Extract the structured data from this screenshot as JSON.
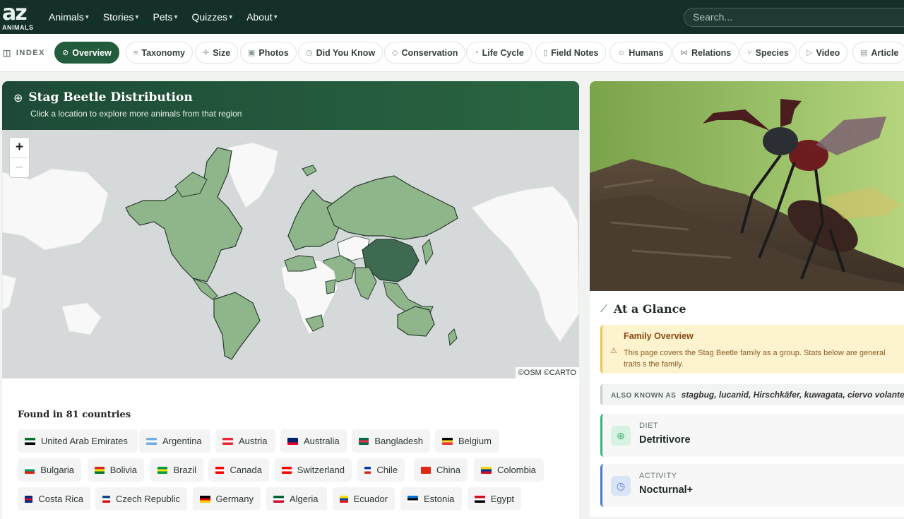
{
  "header": {
    "logo_main": "az",
    "logo_sub": "ANIMALS",
    "nav": [
      "Animals",
      "Stories",
      "Pets",
      "Quizzes",
      "About"
    ],
    "search_placeholder": "Search..."
  },
  "index_bar": {
    "label": "INDEX",
    "items": [
      {
        "label": "Overview",
        "icon": "compass-icon",
        "active": true
      },
      {
        "label": "Taxonomy",
        "icon": "list-icon"
      },
      {
        "label": "Size",
        "icon": "ruler-icon"
      },
      {
        "label": "Photos",
        "icon": "image-icon"
      },
      {
        "label": "Did You Know",
        "icon": "help-circle-icon"
      },
      {
        "label": "Conservation",
        "icon": "shield-icon"
      },
      {
        "label": "Life Cycle",
        "icon": "clock-icon"
      },
      {
        "label": "Field Notes",
        "icon": "clipboard-icon"
      },
      {
        "label": "Humans",
        "icon": "users-icon"
      },
      {
        "label": "Relations",
        "icon": "share-icon"
      },
      {
        "label": "Species",
        "icon": "branch-icon"
      },
      {
        "label": "Video",
        "icon": "play-icon"
      },
      {
        "label": "Article",
        "icon": "document-icon"
      }
    ]
  },
  "map": {
    "title": "Stag Beetle Distribution",
    "subtitle": "Click a location to explore more animals from that region",
    "zoom_in": "+",
    "zoom_out": "−",
    "attribution": "©OSM ©CARTO",
    "colors": {
      "ocean": "#d5d9da",
      "land": "#f7f8f7",
      "present": "#8fb58a",
      "highlight": "#3d6a51",
      "border": "#253b2d"
    }
  },
  "countries": {
    "heading": "Found in 81 countries",
    "list": [
      {
        "name": "United Arab Emirates",
        "flag": [
          "#00732f",
          "#ffffff",
          "#000000"
        ]
      },
      {
        "name": "Argentina",
        "flag": [
          "#74acdf",
          "#ffffff",
          "#74acdf"
        ]
      },
      {
        "name": "Austria",
        "flag": [
          "#ed2939",
          "#ffffff",
          "#ed2939"
        ]
      },
      {
        "name": "Australia",
        "flag": [
          "#012169",
          "#012169",
          "#e4002b"
        ]
      },
      {
        "name": "Bangladesh",
        "flag": [
          "#006a4e",
          "#f42a41",
          "#006a4e"
        ]
      },
      {
        "name": "Belgium",
        "flag": [
          "#000000",
          "#fdda24",
          "#ef3340"
        ]
      },
      {
        "name": "Bulgaria",
        "flag": [
          "#ffffff",
          "#00966e",
          "#d62612"
        ]
      },
      {
        "name": "Bolivia",
        "flag": [
          "#d52b1e",
          "#f9e300",
          "#007934"
        ]
      },
      {
        "name": "Brazil",
        "flag": [
          "#009c3b",
          "#ffdf00",
          "#009c3b"
        ]
      },
      {
        "name": "Canada",
        "flag": [
          "#ff0000",
          "#ffffff",
          "#ff0000"
        ]
      },
      {
        "name": "Switzerland",
        "flag": [
          "#ff0000",
          "#ffffff",
          "#ff0000"
        ]
      },
      {
        "name": "Chile",
        "flag": [
          "#0039a6",
          "#ffffff",
          "#d52b1e"
        ]
      },
      {
        "name": "China",
        "flag": [
          "#de2910",
          "#de2910",
          "#de2910"
        ]
      },
      {
        "name": "Colombia",
        "flag": [
          "#fcd116",
          "#003893",
          "#ce1126"
        ]
      },
      {
        "name": "Costa Rica",
        "flag": [
          "#002b7f",
          "#ce1126",
          "#002b7f"
        ]
      },
      {
        "name": "Czech Republic",
        "flag": [
          "#11457e",
          "#ffffff",
          "#d7141a"
        ]
      },
      {
        "name": "Germany",
        "flag": [
          "#000000",
          "#dd0000",
          "#ffce00"
        ]
      },
      {
        "name": "Algeria",
        "flag": [
          "#006233",
          "#ffffff",
          "#d21034"
        ]
      },
      {
        "name": "Ecuador",
        "flag": [
          "#ffdd00",
          "#034ea2",
          "#ed1c24"
        ]
      },
      {
        "name": "Estonia",
        "flag": [
          "#0072ce",
          "#000000",
          "#ffffff"
        ]
      },
      {
        "name": "Egypt",
        "flag": [
          "#ce1126",
          "#ffffff",
          "#000000"
        ]
      }
    ]
  },
  "glance": {
    "title": "At a Glance",
    "family_title": "Family Overview",
    "family_text": "This page covers the Stag Beetle family as a group. Stats below are general traits s the family.",
    "aka_label": "ALSO KNOWN AS",
    "aka_names": "stagbug, lucanid, Hirschkäfer, kuwagata, ciervo volante, l",
    "stats": [
      {
        "label": "DIET",
        "value": "Detritivore",
        "icon": "leaf-icon",
        "color": "#3bb372",
        "bg": "#d7f1e2"
      },
      {
        "label": "ACTIVITY",
        "value": "Nocturnal+",
        "icon": "clock-icon",
        "color": "#4978c9",
        "bg": "#d9e4f7"
      }
    ]
  }
}
